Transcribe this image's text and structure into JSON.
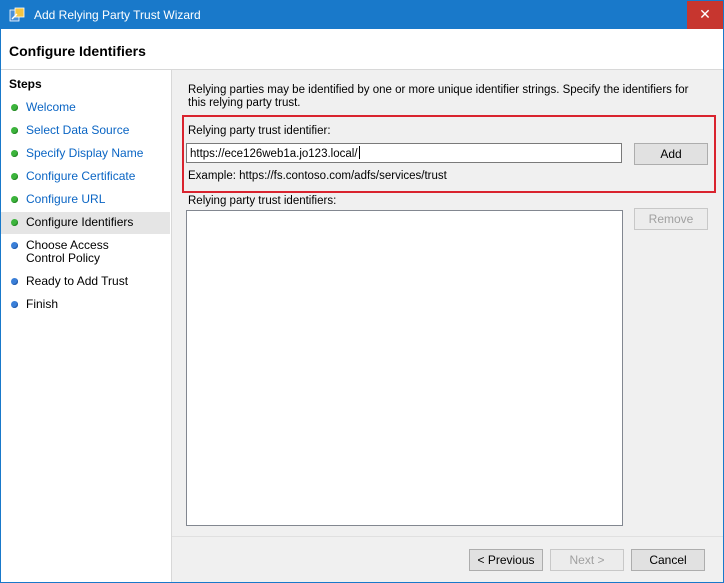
{
  "window": {
    "title": "Add Relying Party Trust Wizard",
    "close_glyph": "✕",
    "icon": "wizard-trust-icon"
  },
  "header": {
    "title": "Configure Identifiers"
  },
  "steps": {
    "title": "Steps",
    "items": [
      {
        "label": "Welcome",
        "status": "complete"
      },
      {
        "label": "Select Data Source",
        "status": "complete"
      },
      {
        "label": "Specify Display Name",
        "status": "complete"
      },
      {
        "label": "Configure Certificate",
        "status": "complete"
      },
      {
        "label": "Configure URL",
        "status": "complete"
      },
      {
        "label": "Configure Identifiers",
        "status": "current"
      },
      {
        "label": "Choose Access Control Policy",
        "status": "pending"
      },
      {
        "label": "Ready to Add Trust",
        "status": "pending"
      },
      {
        "label": "Finish",
        "status": "pending"
      }
    ]
  },
  "main": {
    "intro": "Relying parties may be identified by one or more unique identifier strings. Specify the identifiers for this relying party trust.",
    "identifier_label": "Relying party trust identifier:",
    "identifier_value": "https://ece126web1a.jo123.local/",
    "add_label": "Add",
    "example": "Example: https://fs.contoso.com/adfs/services/trust",
    "identifiers_label": "Relying party trust identifiers:",
    "remove_label": "Remove"
  },
  "footer": {
    "previous_label": "< Previous",
    "next_label": "Next >",
    "cancel_label": "Cancel"
  },
  "colors": {
    "titlebar": "#1979ca",
    "link": "#0a65c4",
    "highlight": "#d9232e",
    "complete": "#3cb43c",
    "pending": "#3a7fd8"
  }
}
